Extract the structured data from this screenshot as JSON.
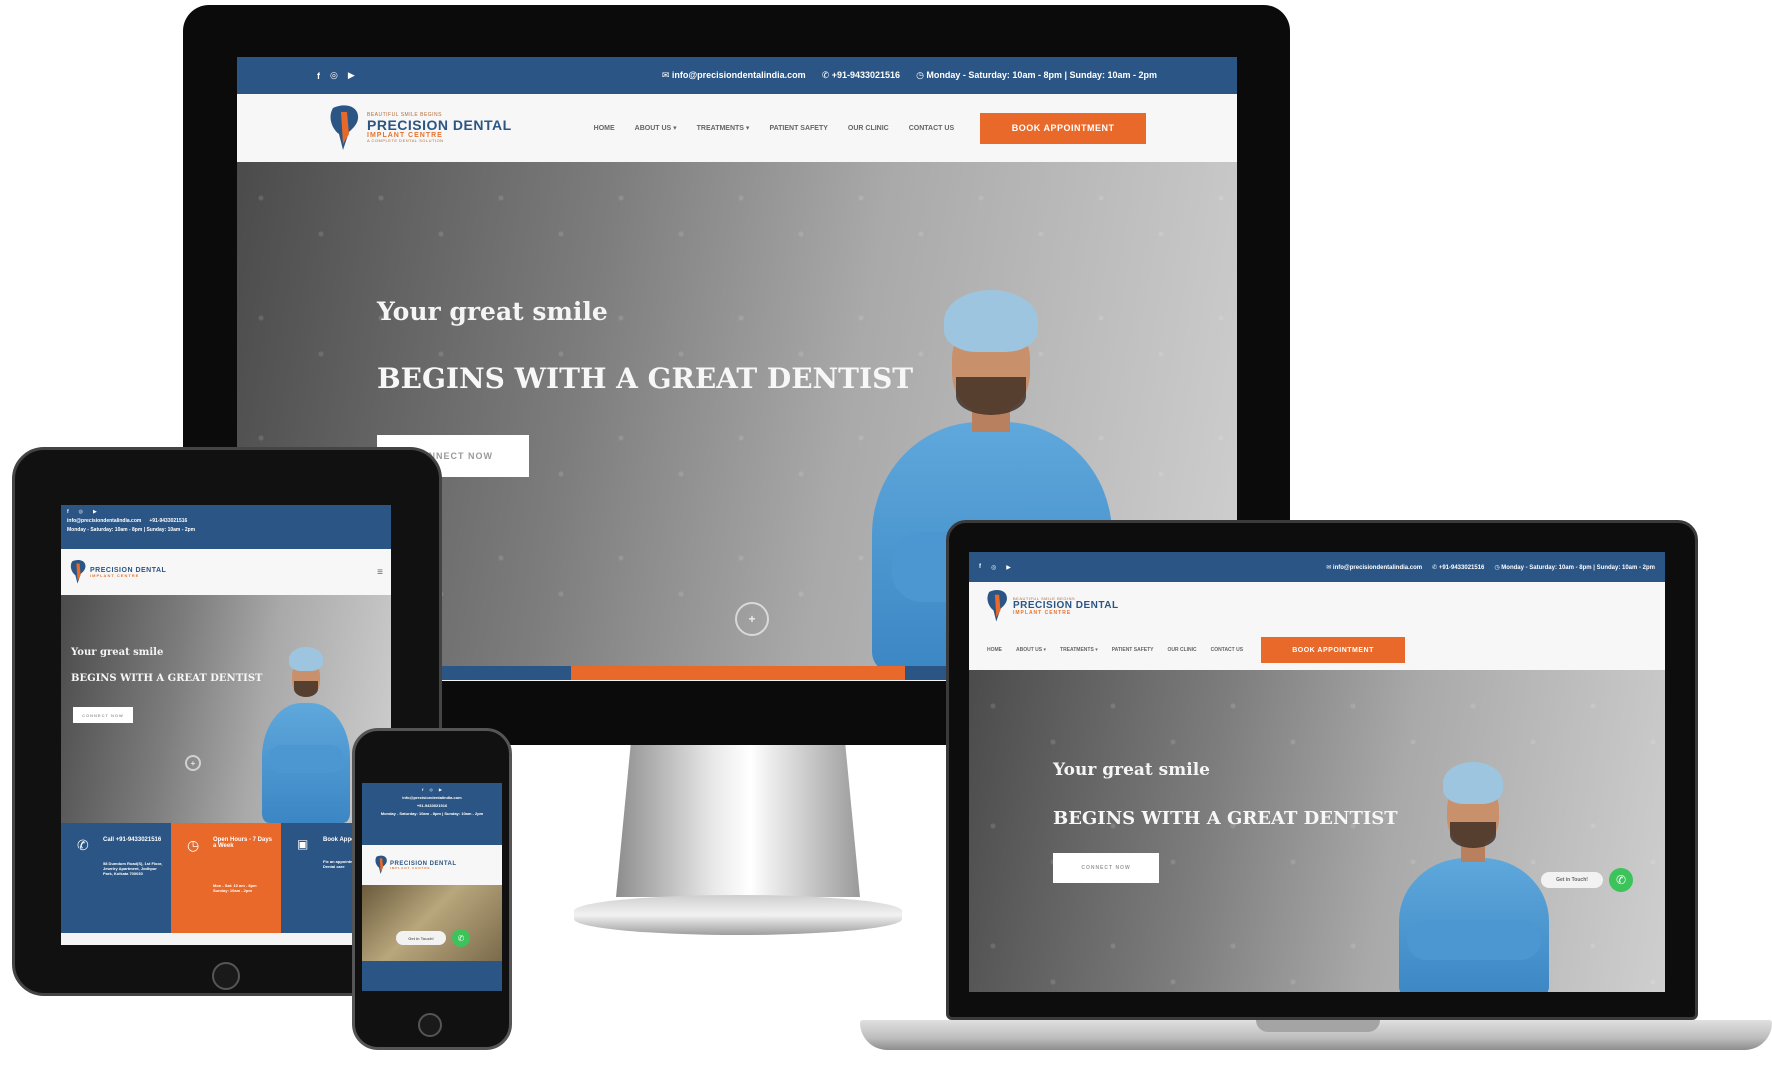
{
  "site": {
    "email": "info@precisiondentalindia.com",
    "phone": "+91-9433021516",
    "hours": "Monday - Saturday: 10am - 8pm | Sunday: 10am - 2pm",
    "social": [
      "f",
      "◎",
      "▶"
    ],
    "logo": {
      "tagline": "BEAUTIFUL SMILE BEGINS",
      "brand": "PRECISION DENTAL",
      "sub": "IMPLANT CENTRE",
      "foot": "A COMPLETE DENTAL SOLUTION"
    },
    "menu": [
      "HOME",
      "ABOUT US ▾",
      "TREATMENTS ▾",
      "PATIENT SAFETY",
      "OUR CLINIC",
      "CONTACT US"
    ],
    "book_label": "BOOK APPOINTMENT",
    "hero": {
      "line1": "Your great smile",
      "line2": "BEGINS WITH A GREAT DENTIST",
      "cta": "CONNECT NOW"
    },
    "tablet_info": [
      {
        "title": "Call +91-9433021516",
        "body": "58 Dumdum Road(S), 1st Floor, Jewelry Apartment, Jodhpur Park, Kolkata 700030"
      },
      {
        "title": "Open Hours - 7 Days a Week",
        "body": "Mon - Sat: 10 am - 8pm Sunday: 10am - 2pm"
      },
      {
        "title": "Book Appointment",
        "body": "Fix an appointment with our Dental care"
      }
    ],
    "get_in_touch": "Get in Touch!"
  },
  "colors": {
    "primary_blue": "#2b5584",
    "accent_orange": "#e8692a",
    "whatsapp_green": "#3cc35a"
  },
  "icons": [
    "facebook-icon",
    "instagram-icon",
    "youtube-icon",
    "email-icon",
    "phone-icon",
    "clock-icon",
    "scroll-down-icon",
    "whatsapp-icon",
    "hamburger-menu-icon"
  ]
}
